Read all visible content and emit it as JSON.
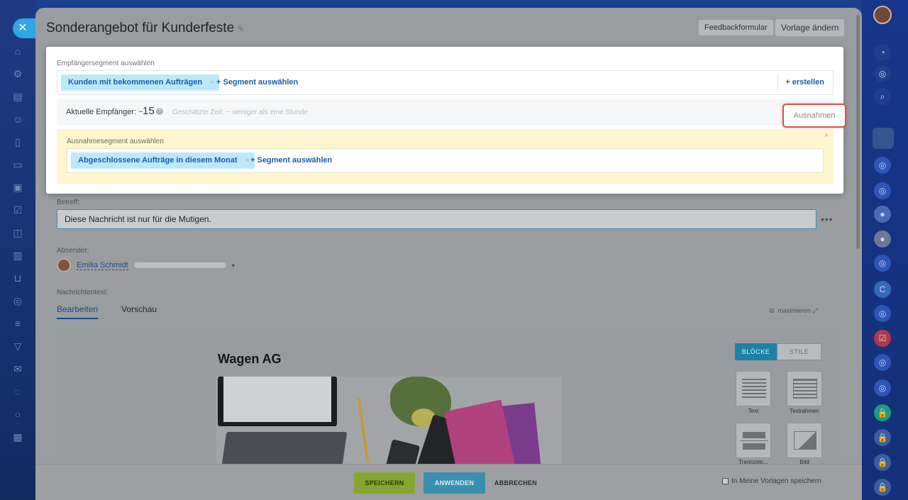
{
  "header": {
    "title": "Sonderangebot für Kunderfeste",
    "feedback_btn": "Feedbackformular",
    "template_btn": "Vorlage ändern"
  },
  "segment": {
    "label": "Empfängersegment auswählen",
    "chip": "Kunden mit bekommenen Aufträgen",
    "add": "+ Segment auswählen",
    "create": "+ erstellen"
  },
  "recipients": {
    "label": "Aktuelle Empfänger: ~",
    "count": "15",
    "help": "?",
    "estimate": "Geschätzte Zeit: ~ weniger als eine Stunde",
    "exclusions_btn": "Ausnahmen"
  },
  "exclusion": {
    "label": "Ausnahmesegment auswählen",
    "chip": "Abgeschlossene Aufträge in diesem Monat",
    "add": "+ Segment auswählen",
    "close": "×"
  },
  "form": {
    "subject_label": "Betreff:",
    "subject_value": "Diese Nachricht ist nur für die Mutigen.",
    "sender_label": "Absender:",
    "sender_name": "Emilia Schmidt",
    "body_label": "Nachrichtentext:",
    "tab_edit": "Bearbeiten",
    "tab_preview": "Vorschau",
    "maximize": "maximieren"
  },
  "editor": {
    "email_title": "Wagen AG",
    "tab_blocks": "BLÖCKE",
    "tab_styles": "STILE",
    "blocks": [
      "Text",
      "Textrahmen",
      "Trennzeic...",
      "Bild"
    ]
  },
  "footer": {
    "save": "SPEICHERN",
    "apply": "ANWENDEN",
    "cancel": "ABBRECHEN",
    "save_template": "In Meine Vorlagen speichern"
  }
}
